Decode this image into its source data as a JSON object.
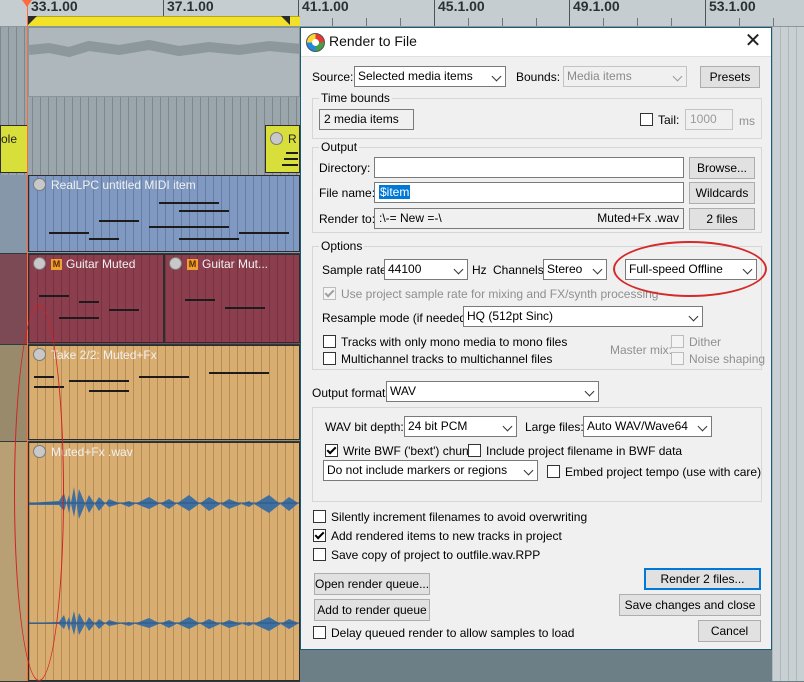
{
  "ruler": {
    "labels": [
      "33.1.00",
      "37.1.00",
      "41.1.00",
      "45.1.00",
      "49.1.00",
      "53.1.00"
    ]
  },
  "tracks": {
    "item_top_left": "ole",
    "item_top_right": "R",
    "midi_item": "RealLPC untitled MIDI item",
    "guitar_item_1": "Guitar Muted",
    "guitar_item_2": "Guitar Mut...",
    "take_item": "Take 2/2: Muted+Fx",
    "wave_item": "Muted+Fx .wav",
    "m_badge": "M"
  },
  "dialog": {
    "title": "Render to File",
    "close": "✕",
    "source_label": "Source:",
    "source_value": "Selected media items",
    "bounds_label": "Bounds:",
    "bounds_value": "Media items",
    "presets_button": "Presets",
    "time_bounds": {
      "title": "Time bounds",
      "value": "2 media items",
      "tail_label": "Tail:",
      "tail_value": "1000",
      "tail_unit": "ms"
    },
    "output": {
      "title": "Output",
      "directory_label": "Directory:",
      "directory_value": "",
      "browse_button": "Browse...",
      "filename_label": "File name:",
      "filename_value": "$item",
      "wildcards_button": "Wildcards",
      "render_to_label": "Render to:",
      "render_to_value_start": ":\\-= New =-\\",
      "render_to_value_end": "Muted+Fx .wav",
      "files_button": "2 files"
    },
    "options": {
      "title": "Options",
      "sample_rate_label": "Sample rate:",
      "sample_rate_value": "44100",
      "hz": "Hz",
      "channels_label": "Channels:",
      "channels_value": "Stereo",
      "speed_value": "Full-speed Offline",
      "use_project_rate": "Use project sample rate for mixing and FX/synth processing",
      "resample_label": "Resample mode (if needed):",
      "resample_value": "HQ (512pt Sinc)",
      "mono_tracks": "Tracks with only mono media to mono files",
      "multichannel": "Multichannel tracks to multichannel files",
      "master_mix": "Master mix:",
      "dither": "Dither",
      "noise_shaping": "Noise shaping"
    },
    "format": {
      "label": "Output format:",
      "value": "WAV",
      "bit_depth_label": "WAV bit depth:",
      "bit_depth_value": "24 bit PCM",
      "large_files_label": "Large files:",
      "large_files_value": "Auto WAV/Wave64",
      "write_bwf": "Write BWF ('bext') chunk",
      "include_filename": "Include project filename in BWF data",
      "markers_value": "Do not include markers or regions",
      "embed_tempo": "Embed project tempo (use with care)"
    },
    "bottom": {
      "silently_increment": "Silently increment filenames to avoid overwriting",
      "add_rendered": "Add rendered items to new tracks in project",
      "save_copy": "Save copy of project to outfile.wav.RPP",
      "open_queue": "Open render queue...",
      "add_queue": "Add to render queue",
      "delay_queued": "Delay queued render to allow samples to load",
      "render_button": "Render 2 files...",
      "save_close": "Save changes and close",
      "cancel": "Cancel"
    }
  }
}
